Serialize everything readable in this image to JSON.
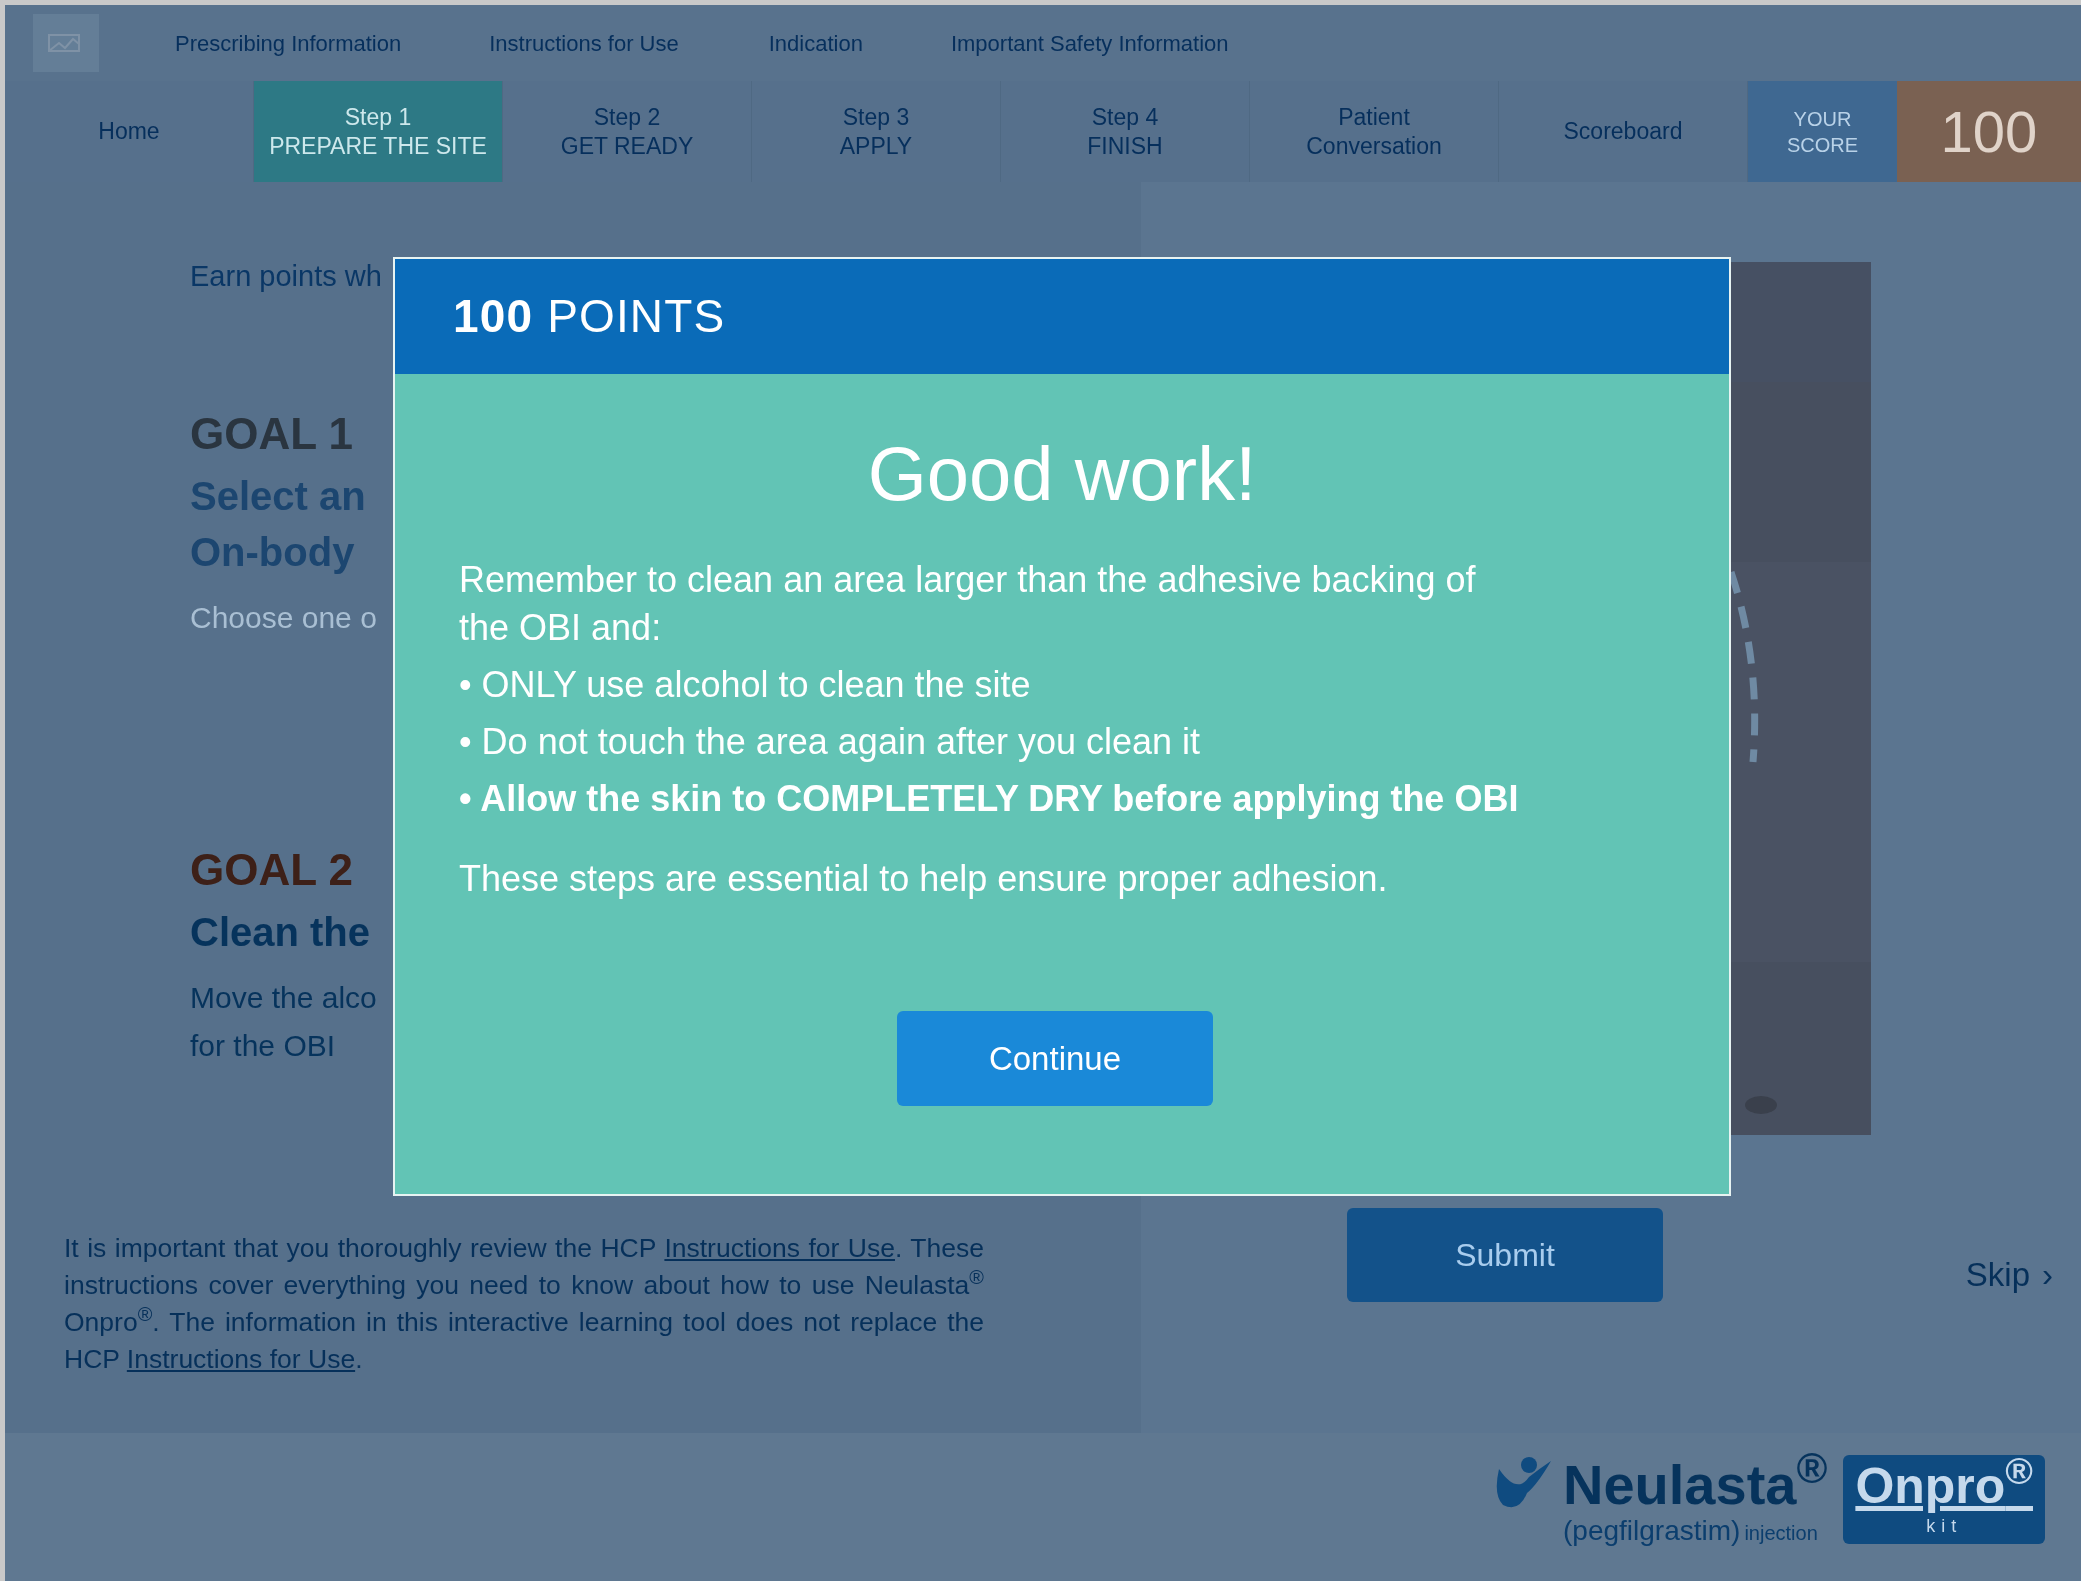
{
  "top_links": [
    {
      "label": "Prescribing Information"
    },
    {
      "label": "Instructions for Use"
    },
    {
      "label": "Indication"
    },
    {
      "label": "Important Safety Information"
    }
  ],
  "nav_tabs": [
    {
      "label": "Home",
      "selected": false
    },
    {
      "label": "Step 1",
      "sublabel": "PREPARE THE SITE",
      "selected": true
    },
    {
      "label": "Step 2",
      "sublabel": "GET READY",
      "selected": false
    },
    {
      "label": "Step 3",
      "sublabel": "APPLY",
      "selected": false
    },
    {
      "label": "Step 4",
      "sublabel": "FINISH",
      "selected": false
    },
    {
      "label": "Patient",
      "sublabel": "Conversation",
      "selected": false
    },
    {
      "label": "Scoreboard",
      "selected": false
    }
  ],
  "score": {
    "label": "YOUR",
    "sublabel": "SCORE",
    "value": "100"
  },
  "intro": "Earn points wh",
  "goals": [
    {
      "heading": "GOAL 1",
      "title_lines": [
        "Select an",
        "On-body"
      ],
      "text_lines": [
        "Choose one o"
      ],
      "active": false
    },
    {
      "heading": "GOAL 2",
      "title_lines": [
        "Clean the"
      ],
      "text_lines": [
        "Move the alco",
        "for the OBI"
      ],
      "active": true
    }
  ],
  "disclaimer": [
    {
      "kind": "text",
      "text": "It is important that you thoroughly review the HCP "
    },
    {
      "kind": "link",
      "text": "Instructions for Use"
    },
    {
      "kind": "text",
      "text": ". These instructions cover everything you need to know about how to use Neulasta$^{®}$ Onpro$^{®}$. The information in this interactive learning tool does not replace the HCP "
    },
    {
      "kind": "link",
      "text": "Instructions for Use"
    },
    {
      "kind": "text",
      "text": "."
    }
  ],
  "submit_button": "Submit",
  "skip": {
    "label": "Skip",
    "arrow": "›"
  },
  "logo": {
    "name": "Neulasta",
    "name_mark": "®",
    "badge": "Onpro",
    "badge_mark": "®",
    "badge_sub": "kit",
    "generic": "(pegfilgrastim)",
    "form": "injection"
  },
  "dialog": {
    "header_points": "100",
    "header_label": "POINTS",
    "title": "Good work!",
    "intro": "Remember to clean an area larger than the adhesive backing of the OBI and:",
    "bullets": [
      {
        "text": "• ONLY use alcohol to clean the site",
        "bold": false
      },
      {
        "text": "• Do not touch the area again after you clean it",
        "bold": false
      },
      {
        "text": "• Allow the skin to COMPLETELY DRY before applying the OBI",
        "bold": true
      }
    ],
    "closing": "These steps are essential to help ensure proper adhesion.",
    "button": "Continue"
  }
}
